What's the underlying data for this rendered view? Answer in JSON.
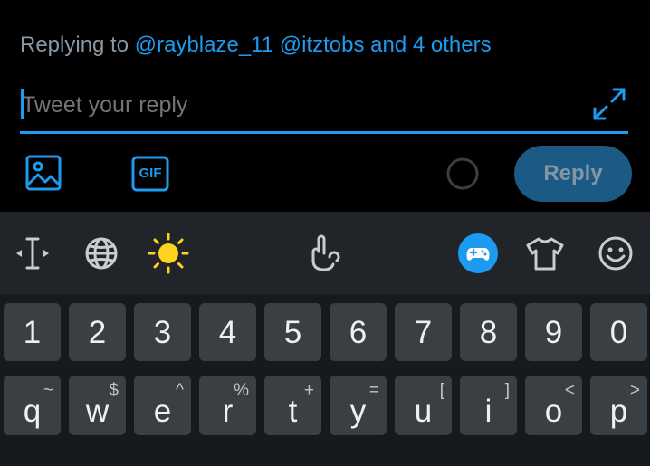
{
  "reply_header": {
    "prefix": "Replying to",
    "mention1": "@rayblaze_11",
    "mention2": "@itztobs",
    "others": "and 4 others"
  },
  "compose": {
    "placeholder": "Tweet your reply",
    "reply_label": "Reply",
    "gif_label": "GIF",
    "reply_enabled": false
  },
  "colors": {
    "accent": "#1d9bf0",
    "background": "#000000",
    "keyboard_bg": "#171a1d",
    "key_bg": "#3a3f44",
    "toolbar_bg": "#212529",
    "sun": "#ffd21f"
  },
  "keyboard_toolbar": {
    "icons": [
      "cursor-icon",
      "globe-icon",
      "sun-icon",
      "gesture-hand-icon",
      "game-controller-icon",
      "tshirt-icon",
      "emoji-icon"
    ]
  },
  "number_row": [
    "1",
    "2",
    "3",
    "4",
    "5",
    "6",
    "7",
    "8",
    "9",
    "0"
  ],
  "letter_row": [
    {
      "key": "q",
      "alt": "~"
    },
    {
      "key": "w",
      "alt": "$"
    },
    {
      "key": "e",
      "alt": "^"
    },
    {
      "key": "r",
      "alt": "%"
    },
    {
      "key": "t",
      "alt": "+"
    },
    {
      "key": "y",
      "alt": "="
    },
    {
      "key": "u",
      "alt": "["
    },
    {
      "key": "i",
      "alt": "]"
    },
    {
      "key": "o",
      "alt": "<"
    },
    {
      "key": "p",
      "alt": ">"
    }
  ]
}
